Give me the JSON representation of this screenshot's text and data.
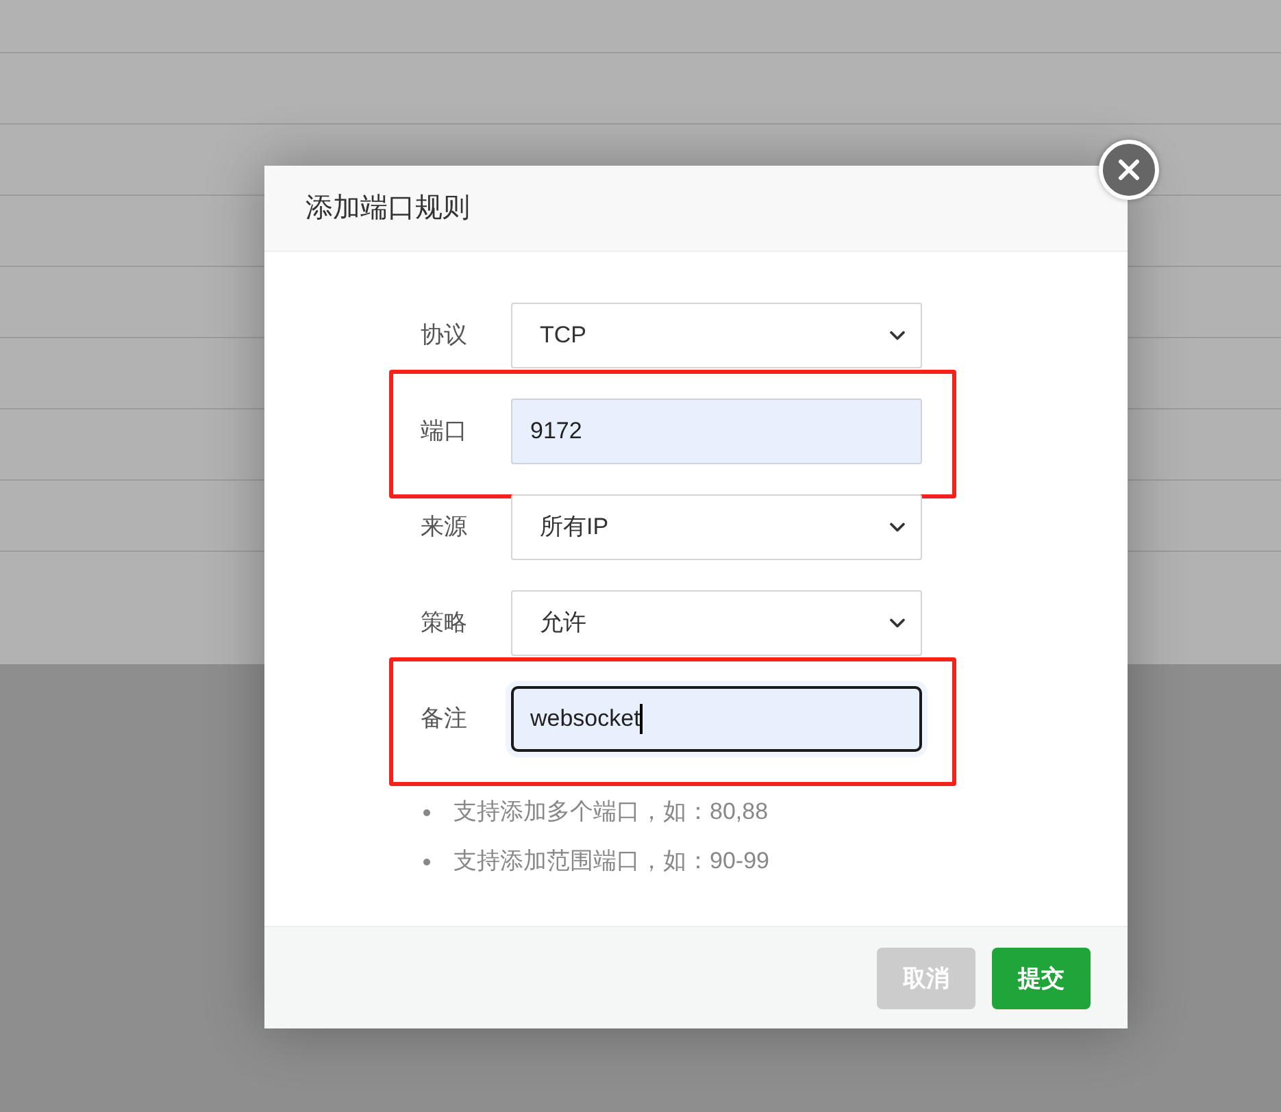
{
  "dialog": {
    "title": "添加端口规则",
    "fields": [
      {
        "kind": "select",
        "label": "协议",
        "value": "TCP",
        "focused": false,
        "highlighted": false
      },
      {
        "kind": "input",
        "label": "端口",
        "value": "9172",
        "focused": false,
        "highlighted": true
      },
      {
        "kind": "select",
        "label": "来源",
        "value": "所有IP",
        "focused": false,
        "highlighted": false
      },
      {
        "kind": "select",
        "label": "策略",
        "value": "允许",
        "focused": false,
        "highlighted": false
      },
      {
        "kind": "input",
        "label": "备注",
        "value": "websocket",
        "focused": true,
        "highlighted": true
      }
    ],
    "tips": [
      "支持添加多个端口，如：80,88",
      "支持添加范围端口，如：90-99"
    ],
    "buttons": [
      {
        "kind": "cancel",
        "label": "取消"
      },
      {
        "kind": "submit",
        "label": "提交"
      }
    ]
  }
}
